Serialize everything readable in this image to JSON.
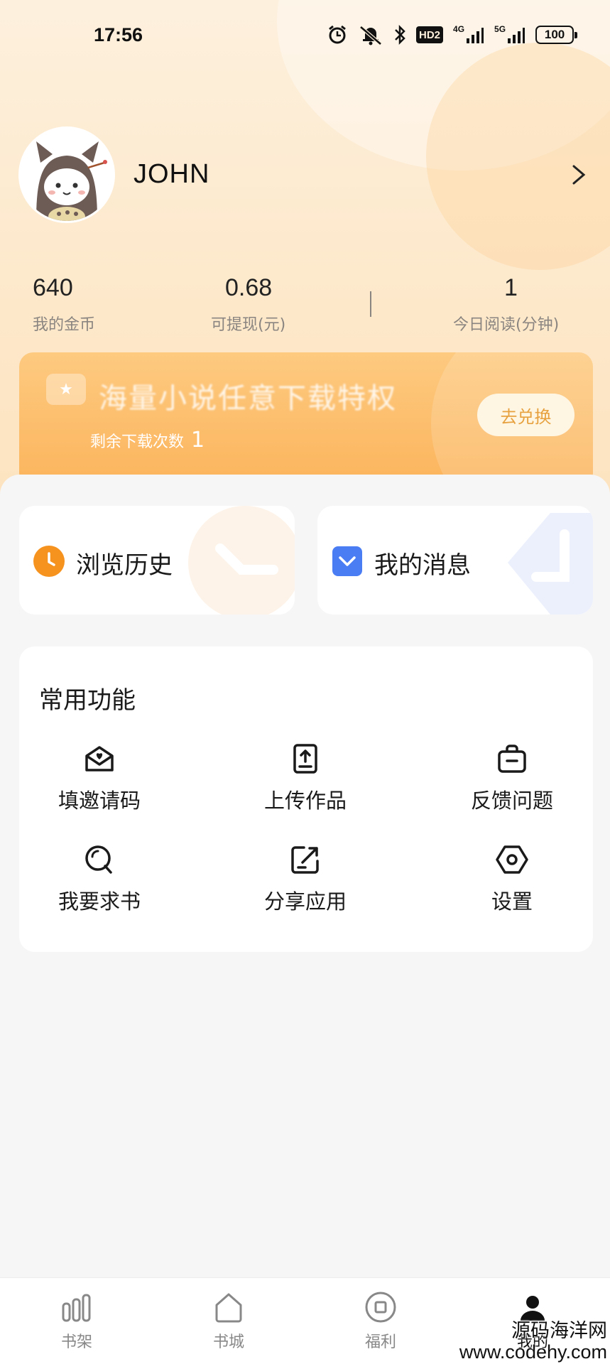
{
  "status_bar": {
    "time": "17:56",
    "icons": [
      "alarm-icon",
      "mute-icon",
      "bluetooth-icon",
      "hd-icon",
      "4g-signal-icon",
      "5g-signal-icon",
      "battery-icon"
    ],
    "hd_label": "HD2",
    "net1_label": "4G",
    "net2_label": "5G",
    "battery": "100"
  },
  "profile": {
    "username": "JOHN",
    "avatar_icon": "avatar-totoro"
  },
  "stats": [
    {
      "value": "640",
      "label": "我的金币"
    },
    {
      "value": "0.68",
      "label": "可提现(元)"
    },
    {
      "value": "1",
      "label": "今日阅读(分钟)"
    }
  ],
  "promo": {
    "title": "海量小说任意下载特权",
    "subtitle": "剩余下载次数",
    "count": "1",
    "button": "去兑换",
    "colors": {
      "start": "#fdca80",
      "end": "#fcb45c",
      "button_text": "#e7a23f"
    }
  },
  "quick": {
    "history": {
      "label": "浏览历史",
      "icon": "clock-icon",
      "color": "#f6921e"
    },
    "messages": {
      "label": "我的消息",
      "icon": "message-check-icon",
      "color": "#4a7df3"
    }
  },
  "tools": {
    "title": "常用功能",
    "items": [
      {
        "label": "填邀请码",
        "icon": "invite-envelope-icon"
      },
      {
        "label": "上传作品",
        "icon": "upload-document-icon"
      },
      {
        "label": "反馈问题",
        "icon": "feedback-bag-icon"
      },
      {
        "label": "我要求书",
        "icon": "search-request-icon"
      },
      {
        "label": "分享应用",
        "icon": "share-icon"
      },
      {
        "label": "设置",
        "icon": "settings-hexagon-icon"
      }
    ]
  },
  "bottom_nav": {
    "items": [
      {
        "label": "书架",
        "icon": "bookshelf-icon"
      },
      {
        "label": "书城",
        "icon": "bookstore-icon"
      },
      {
        "label": "福利",
        "icon": "welfare-icon"
      },
      {
        "label": "我的",
        "icon": "profile-icon"
      }
    ]
  },
  "watermark": {
    "line1": "源码海洋网",
    "line2": "www.codehy.com"
  }
}
